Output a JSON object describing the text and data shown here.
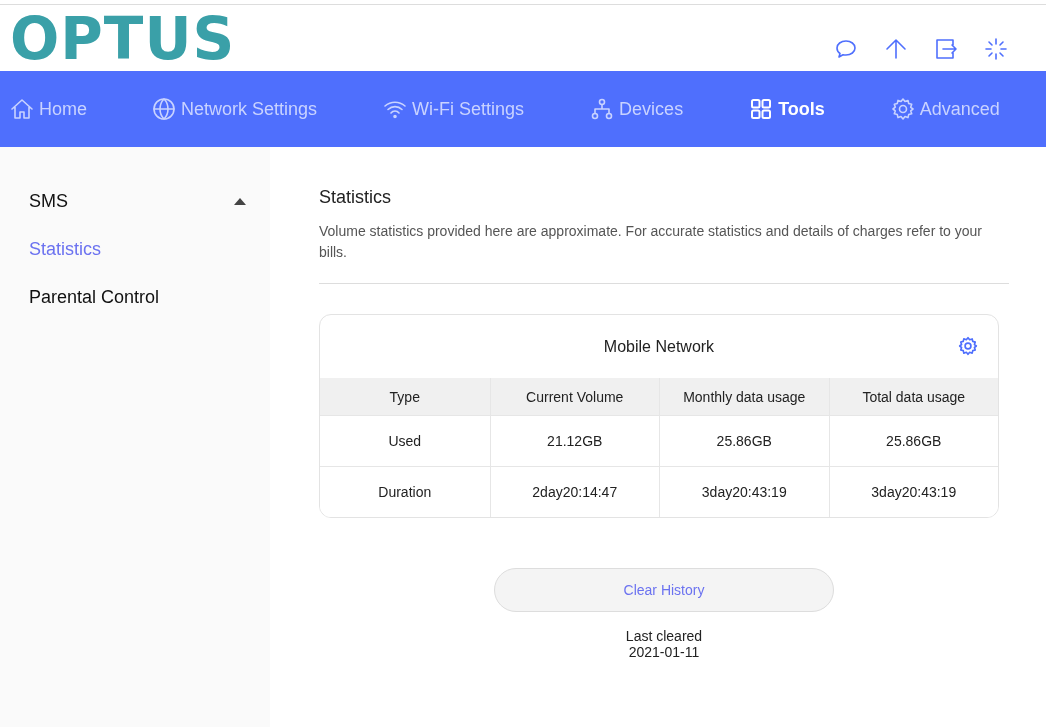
{
  "logo": "OPTUS",
  "header_icons": [
    {
      "kind": "message"
    },
    {
      "kind": "upload"
    },
    {
      "kind": "logout"
    },
    {
      "kind": "loading"
    }
  ],
  "nav": [
    {
      "label": "Home",
      "kind": "home",
      "selected": false
    },
    {
      "label": "Network Settings",
      "kind": "globe",
      "selected": false
    },
    {
      "label": "Wi-Fi Settings",
      "kind": "wifi",
      "selected": false
    },
    {
      "label": "Devices",
      "kind": "devices",
      "selected": false
    },
    {
      "label": "Tools",
      "kind": "grid",
      "selected": true
    },
    {
      "label": "Advanced",
      "kind": "gear",
      "selected": false
    }
  ],
  "sidebar": {
    "items": [
      {
        "label": "SMS",
        "kind": "dropdown",
        "selected": false
      },
      {
        "label": "Statistics",
        "kind": "link",
        "selected": true
      },
      {
        "label": "Parental Control",
        "kind": "link",
        "selected": false
      }
    ]
  },
  "page": {
    "title": "Statistics",
    "description": "Volume statistics provided here are approximate. For accurate statistics and details of charges refer to your bills."
  },
  "card": {
    "title": "Mobile Network",
    "table": {
      "columns": [
        "Type",
        "Current Volume",
        "Monthly data usage",
        "Total data usage"
      ],
      "rows": [
        [
          "Used",
          "21.12GB",
          "25.86GB",
          "25.86GB"
        ],
        [
          "Duration",
          "2day20:14:47",
          "3day20:43:19",
          "3day20:43:19"
        ]
      ]
    }
  },
  "clear_button": "Clear History",
  "last_cleared": {
    "label": "Last cleared",
    "date": "2021-01-11"
  }
}
